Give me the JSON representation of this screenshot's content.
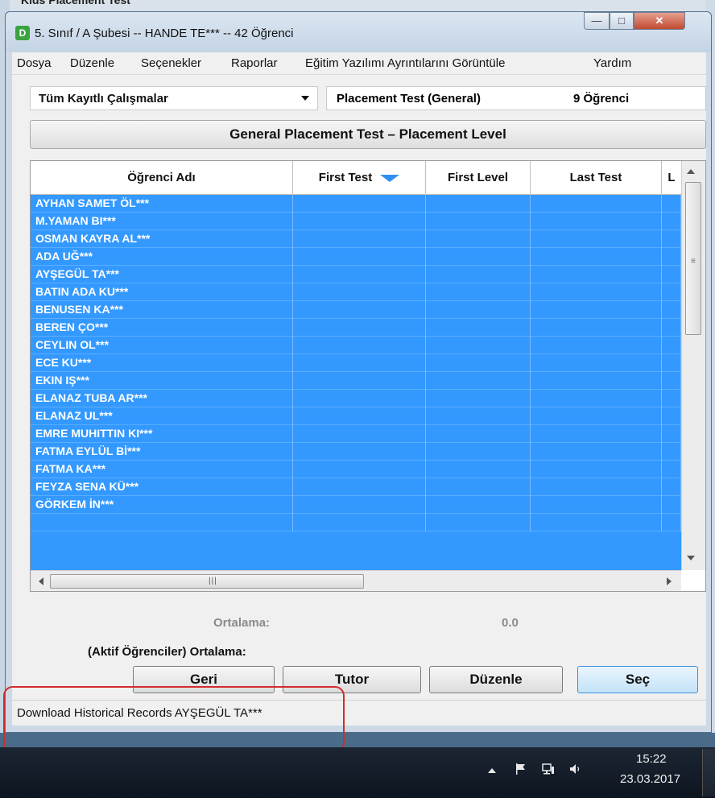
{
  "window": {
    "title": "5. Sınıf / A Şubesi -- HANDE TE*** -- 42 Öğrenci",
    "icon_letter": "D",
    "background_title": "Kids Placement Test"
  },
  "menu": [
    "Dosya",
    "Düzenle",
    "Seçenekler",
    "Raporlar",
    "Eğitim Yazılımı Ayrıntılarını Görüntüle",
    "Yardım"
  ],
  "filter": {
    "combo_value": "Tüm Kayıtlı Çalışmalar",
    "test_name": "Placement Test (General)",
    "student_count": "9 Öğrenci"
  },
  "heading": "General Placement Test  –  Placement Level",
  "grid": {
    "columns": [
      "Öğrenci Adı",
      "First Test",
      "First Level",
      "Last Test",
      "L"
    ],
    "sort_column": "First Test",
    "selection_color": "#3399ff",
    "rows": [
      "AYHAN SAMET ÖL***",
      "M.YAMAN BI***",
      "OSMAN KAYRA AL***",
      "ADA UĞ***",
      "AYŞEGÜL TA***",
      "BATIN ADA KU***",
      "BENUSEN KA***",
      "BEREN ÇO***",
      "CEYLIN OL***",
      "ECE KU***",
      "EKIN IŞ***",
      "ELANAZ TUBA AR***",
      "ELANAZ UL***",
      "EMRE MUHITTIN KI***",
      "FATMA EYLÜL Bİ***",
      "FATMA KA***",
      "FEYZA SENA KÜ***",
      "GÖRKEM İN***",
      ""
    ]
  },
  "stats": {
    "ortalama_label": "Ortalama:",
    "ortalama_value": "0.0",
    "aktif_label": "(Aktif Öğrenciler) Ortalama:"
  },
  "buttons": {
    "geri": "Geri",
    "tutor": "Tutor",
    "duzenle": "Düzenle",
    "sec": "Seç"
  },
  "statusbar": {
    "text": "Download Historical Records   AYŞEGÜL TA***"
  },
  "taskbar": {
    "time": "15:22",
    "date": "23.03.2017",
    "tray_icons": [
      "show-hidden-icon",
      "flag-icon",
      "network-icon",
      "volume-icon"
    ]
  },
  "annotation_color": "#d42a2a"
}
